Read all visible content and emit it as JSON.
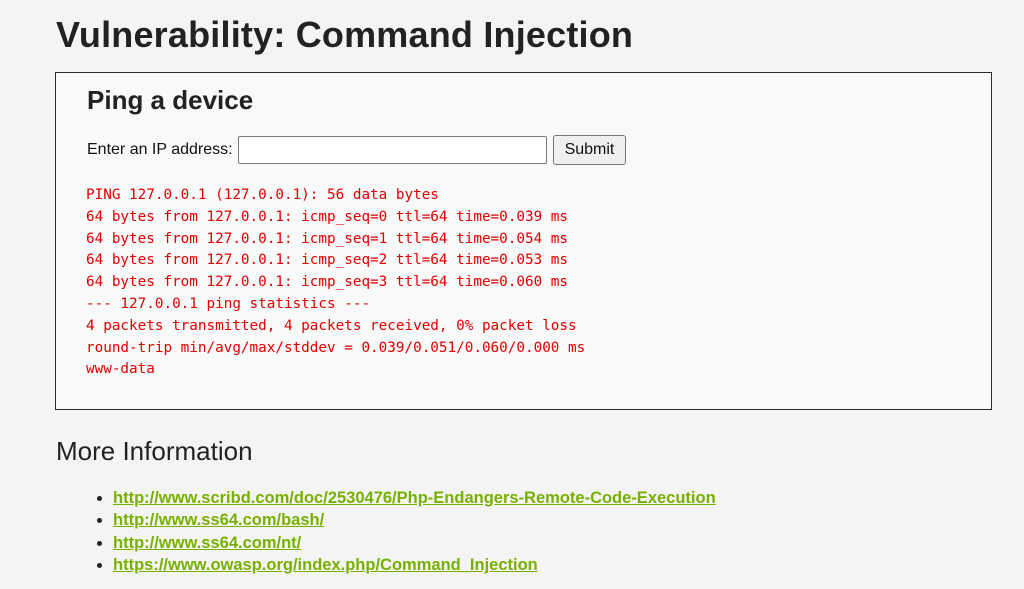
{
  "page": {
    "title": "Vulnerability: Command Injection"
  },
  "ping_form": {
    "heading": "Ping a device",
    "ip_label": "Enter an IP address:",
    "ip_value": "",
    "submit_label": "Submit"
  },
  "output": {
    "lines": [
      "PING 127.0.0.1 (127.0.0.1): 56 data bytes",
      "64 bytes from 127.0.0.1: icmp_seq=0 ttl=64 time=0.039 ms",
      "64 bytes from 127.0.0.1: icmp_seq=1 ttl=64 time=0.054 ms",
      "64 bytes from 127.0.0.1: icmp_seq=2 ttl=64 time=0.053 ms",
      "64 bytes from 127.0.0.1: icmp_seq=3 ttl=64 time=0.060 ms",
      "--- 127.0.0.1 ping statistics ---",
      "4 packets transmitted, 4 packets received, 0% packet loss",
      "round-trip min/avg/max/stddev = 0.039/0.051/0.060/0.000 ms",
      "www-data"
    ]
  },
  "more_info": {
    "heading": "More Information",
    "links": [
      "http://www.scribd.com/doc/2530476/Php-Endangers-Remote-Code-Execution",
      "http://www.ss64.com/bash/",
      "http://www.ss64.com/nt/",
      "https://www.owasp.org/index.php/Command_Injection"
    ]
  },
  "colors": {
    "output_text": "#e00000",
    "link": "#78b000",
    "background": "#f4f4f4"
  }
}
